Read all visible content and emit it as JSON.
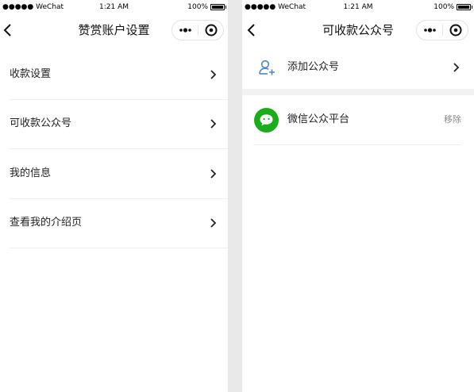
{
  "screens": {
    "left": {
      "status": {
        "carrier": "●●●●● WeChat",
        "time": "1:21 AM",
        "battery": "100%"
      },
      "title": "赞赏账户设置",
      "menu": [
        {
          "label": "收款设置"
        },
        {
          "label": "可收款公众号"
        },
        {
          "label": "我的信息"
        },
        {
          "label": "查看我的介绍页"
        }
      ]
    },
    "right": {
      "status": {
        "carrier": "●●●●● WeChat",
        "time": "1:21 AM",
        "battery": "100%"
      },
      "title": "可收款公众号",
      "add_label": "添加公众号",
      "account": {
        "name": "微信公众平台",
        "action": "移除"
      }
    }
  },
  "icons": {
    "back": "chevron-left-icon",
    "more": "more-dots-icon",
    "close": "capsule-close-icon",
    "row_arrow": "chevron-right-icon",
    "add_account": "add-person-icon",
    "account_logo": "wechat-bubble-icon"
  },
  "colors": {
    "accent_blue": "#4c84d4",
    "wechat_green": "#1aad19",
    "remove_gray": "#8a8a8a",
    "section_gap": "#f1f2f4"
  }
}
